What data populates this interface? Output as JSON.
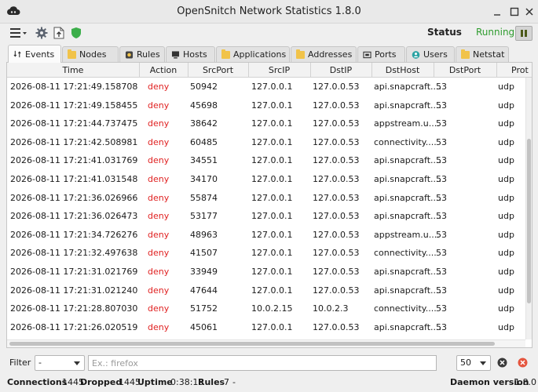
{
  "window": {
    "title": "OpenSnitch Network Statistics 1.8.0"
  },
  "toolbar": {
    "status_label": "Status",
    "status_value": "Running"
  },
  "tabs": [
    {
      "label": "Events",
      "icon": "events-icon"
    },
    {
      "label": "Nodes",
      "icon": "folder-icon"
    },
    {
      "label": "Rules",
      "icon": "rules-icon"
    },
    {
      "label": "Hosts",
      "icon": "monitor-icon"
    },
    {
      "label": "Applications",
      "icon": "folder-icon"
    },
    {
      "label": "Addresses",
      "icon": "folder-icon"
    },
    {
      "label": "Ports",
      "icon": "ports-icon"
    },
    {
      "label": "Users",
      "icon": "user-icon"
    },
    {
      "label": "Netstat",
      "icon": "folder-icon"
    }
  ],
  "table": {
    "columns": [
      "Time",
      "Action",
      "SrcPort",
      "SrcIP",
      "DstIP",
      "DstHost",
      "DstPort",
      "Prot"
    ],
    "rows": [
      [
        "2026-08-11 17:21:49.158708",
        "deny",
        "50942",
        "127.0.0.1",
        "127.0.0.53",
        "api.snapcraft....",
        "53",
        "udp"
      ],
      [
        "2026-08-11 17:21:49.158455",
        "deny",
        "45698",
        "127.0.0.1",
        "127.0.0.53",
        "api.snapcraft....",
        "53",
        "udp"
      ],
      [
        "2026-08-11 17:21:44.737475",
        "deny",
        "38642",
        "127.0.0.1",
        "127.0.0.53",
        "appstream.u....",
        "53",
        "udp"
      ],
      [
        "2026-08-11 17:21:42.508981",
        "deny",
        "60485",
        "127.0.0.1",
        "127.0.0.53",
        "connectivity....",
        "53",
        "udp"
      ],
      [
        "2026-08-11 17:21:41.031769",
        "deny",
        "34551",
        "127.0.0.1",
        "127.0.0.53",
        "api.snapcraft....",
        "53",
        "udp"
      ],
      [
        "2026-08-11 17:21:41.031548",
        "deny",
        "34170",
        "127.0.0.1",
        "127.0.0.53",
        "api.snapcraft....",
        "53",
        "udp"
      ],
      [
        "2026-08-11 17:21:36.026966",
        "deny",
        "55874",
        "127.0.0.1",
        "127.0.0.53",
        "api.snapcraft....",
        "53",
        "udp"
      ],
      [
        "2026-08-11 17:21:36.026473",
        "deny",
        "53177",
        "127.0.0.1",
        "127.0.0.53",
        "api.snapcraft....",
        "53",
        "udp"
      ],
      [
        "2026-08-11 17:21:34.726276",
        "deny",
        "48963",
        "127.0.0.1",
        "127.0.0.53",
        "appstream.u....",
        "53",
        "udp"
      ],
      [
        "2026-08-11 17:21:32.497638",
        "deny",
        "41507",
        "127.0.0.1",
        "127.0.0.53",
        "connectivity....",
        "53",
        "udp"
      ],
      [
        "2026-08-11 17:21:31.021769",
        "deny",
        "33949",
        "127.0.0.1",
        "127.0.0.53",
        "api.snapcraft....",
        "53",
        "udp"
      ],
      [
        "2026-08-11 17:21:31.021240",
        "deny",
        "47644",
        "127.0.0.1",
        "127.0.0.53",
        "api.snapcraft....",
        "53",
        "udp"
      ],
      [
        "2026-08-11 17:21:28.807030",
        "deny",
        "51752",
        "10.0.2.15",
        "10.0.2.3",
        "connectivity....",
        "53",
        "udp"
      ],
      [
        "2026-08-11 17:21:26.020519",
        "deny",
        "45061",
        "127.0.0.1",
        "127.0.0.53",
        "api.snapcraft....",
        "53",
        "udp"
      ]
    ]
  },
  "filter": {
    "label": "Filter",
    "action_value": "-",
    "placeholder": "Ex.: firefox",
    "limit_value": "50"
  },
  "statusbar": {
    "connections_label": "Connections",
    "connections_value": "1445",
    "dropped_label": "Dropped",
    "dropped_value": "1445",
    "uptime_label": "Uptime",
    "uptime_value": "0:38:13",
    "rules_label": "Rules",
    "rules_value": "7",
    "rules_extra": "-",
    "daemon_label": "Daemon version",
    "daemon_value": "1.8.0"
  },
  "colors": {
    "running": "#2d9b2d",
    "deny": "#e02020",
    "shield": "#3cae4a"
  }
}
